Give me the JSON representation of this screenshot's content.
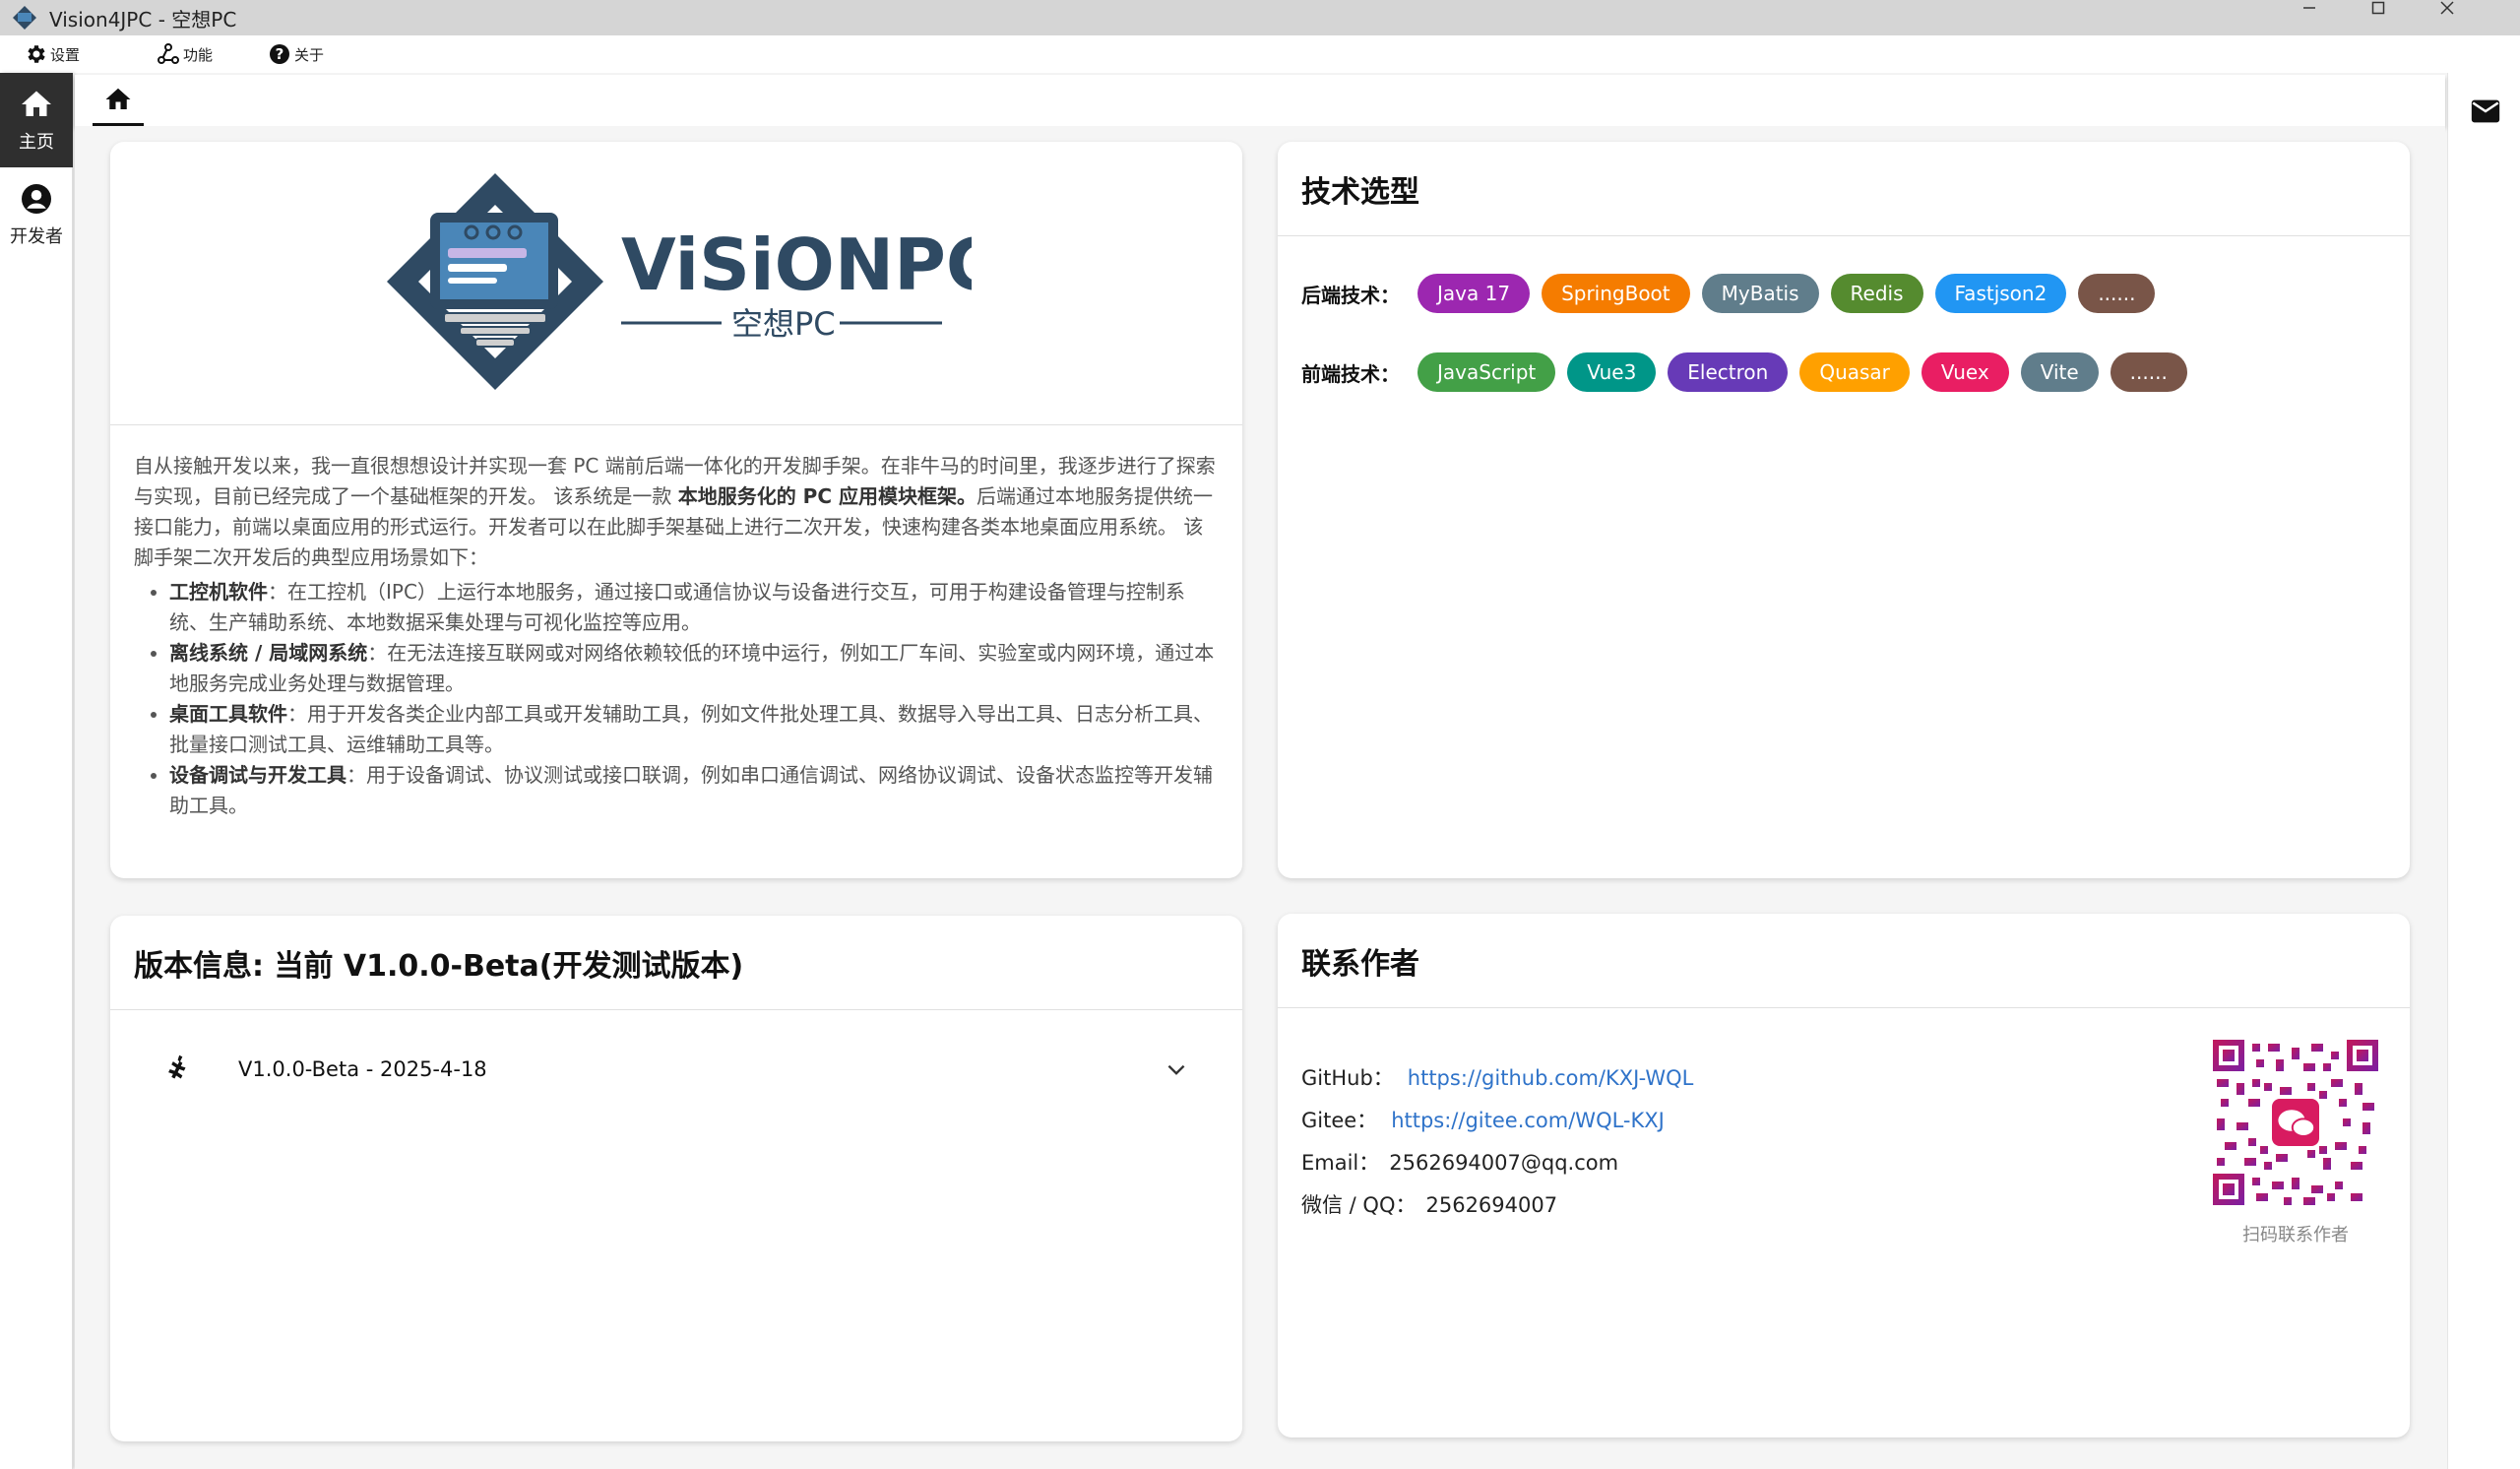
{
  "window": {
    "title": "Vision4JPC - 空想PC",
    "minimize": "—",
    "maximize": "☐",
    "close": "✕"
  },
  "menu": [
    {
      "label": "设置",
      "icon": "gear-icon"
    },
    {
      "label": "功能",
      "icon": "network-icon"
    },
    {
      "label": "关于",
      "icon": "help-icon"
    }
  ],
  "nav": [
    {
      "label": "主页",
      "icon": "home-icon",
      "active": true
    },
    {
      "label": "开发者",
      "icon": "user-circle-icon",
      "active": false
    }
  ],
  "about": {
    "logo": {
      "brand": "ViSiONPC",
      "sub": "空想PC"
    },
    "intro_p1": "自从接触开发以来，我一直很想想设计并实现一套 PC 端前后端一体化的开发脚手架。在非牛马的时间里，我逐步进行了探索与实现，目前已经完成了一个基础框架的开发。 该系统是一款 ",
    "intro_bold": "本地服务化的 PC 应用模块框架。",
    "intro_p2": "后端通过本地服务提供统一接口能力，前端以桌面应用的形式运行。开发者可以在此脚手架基础上进行二次开发，快速构建各类本地桌面应用系统。 该脚手架二次开发后的典型应用场景如下：",
    "scenarios": [
      {
        "title": "工控机软件",
        "desc": "：在工控机（IPC）上运行本地服务，通过接口或通信协议与设备进行交互，可用于构建设备管理与控制系统、生产辅助系统、本地数据采集处理与可视化监控等应用。"
      },
      {
        "title": "离线系统 / 局域网系统",
        "desc": "：在无法连接互联网或对网络依赖较低的环境中运行，例如工厂车间、实验室或内网环境，通过本地服务完成业务处理与数据管理。"
      },
      {
        "title": "桌面工具软件",
        "desc": "：用于开发各类企业内部工具或开发辅助工具，例如文件批处理工具、数据导入导出工具、日志分析工具、批量接口测试工具、运维辅助工具等。"
      },
      {
        "title": "设备调试与开发工具",
        "desc": "：用于设备调试、协议测试或接口联调，例如串口通信调试、网络协议调试、设备状态监控等开发辅助工具。"
      }
    ]
  },
  "tech": {
    "title": "技术选型",
    "backend_label": "后端技术：",
    "backend": [
      {
        "label": "Java 17",
        "color": "#9c27b0"
      },
      {
        "label": "SpringBoot",
        "color": "#f57c00"
      },
      {
        "label": "MyBatis",
        "color": "#607d8b"
      },
      {
        "label": "Redis",
        "color": "#558b2f"
      },
      {
        "label": "Fastjson2",
        "color": "#2196f3"
      },
      {
        "label": "......",
        "color": "#795548"
      }
    ],
    "frontend_label": "前端技术：",
    "frontend": [
      {
        "label": "JavaScript",
        "color": "#43a047"
      },
      {
        "label": "Vue3",
        "color": "#009688"
      },
      {
        "label": "Electron",
        "color": "#673ab7"
      },
      {
        "label": "Quasar",
        "color": "#ffa000"
      },
      {
        "label": "Vuex",
        "color": "#e91e63"
      },
      {
        "label": "Vite",
        "color": "#607d8b"
      },
      {
        "label": "......",
        "color": "#795548"
      }
    ]
  },
  "version": {
    "title": "版本信息: 当前 V1.0.0-Beta(开发测试版本)",
    "items": [
      {
        "label": "V1.0.0-Beta - 2025-4-18",
        "icon": "bug-icon"
      }
    ]
  },
  "contact": {
    "title": "联系作者",
    "github_label": "GitHub：",
    "github_url": "https://github.com/KXJ-WQL",
    "gitee_label": "Gitee：",
    "gitee_url": "https://gitee.com/WQL-KXJ",
    "email_label": "Email：",
    "email": "2562694007@qq.com",
    "wechat_label": "微信 / QQ：",
    "wechat": "2562694007",
    "qr_caption": "扫码联系作者"
  }
}
